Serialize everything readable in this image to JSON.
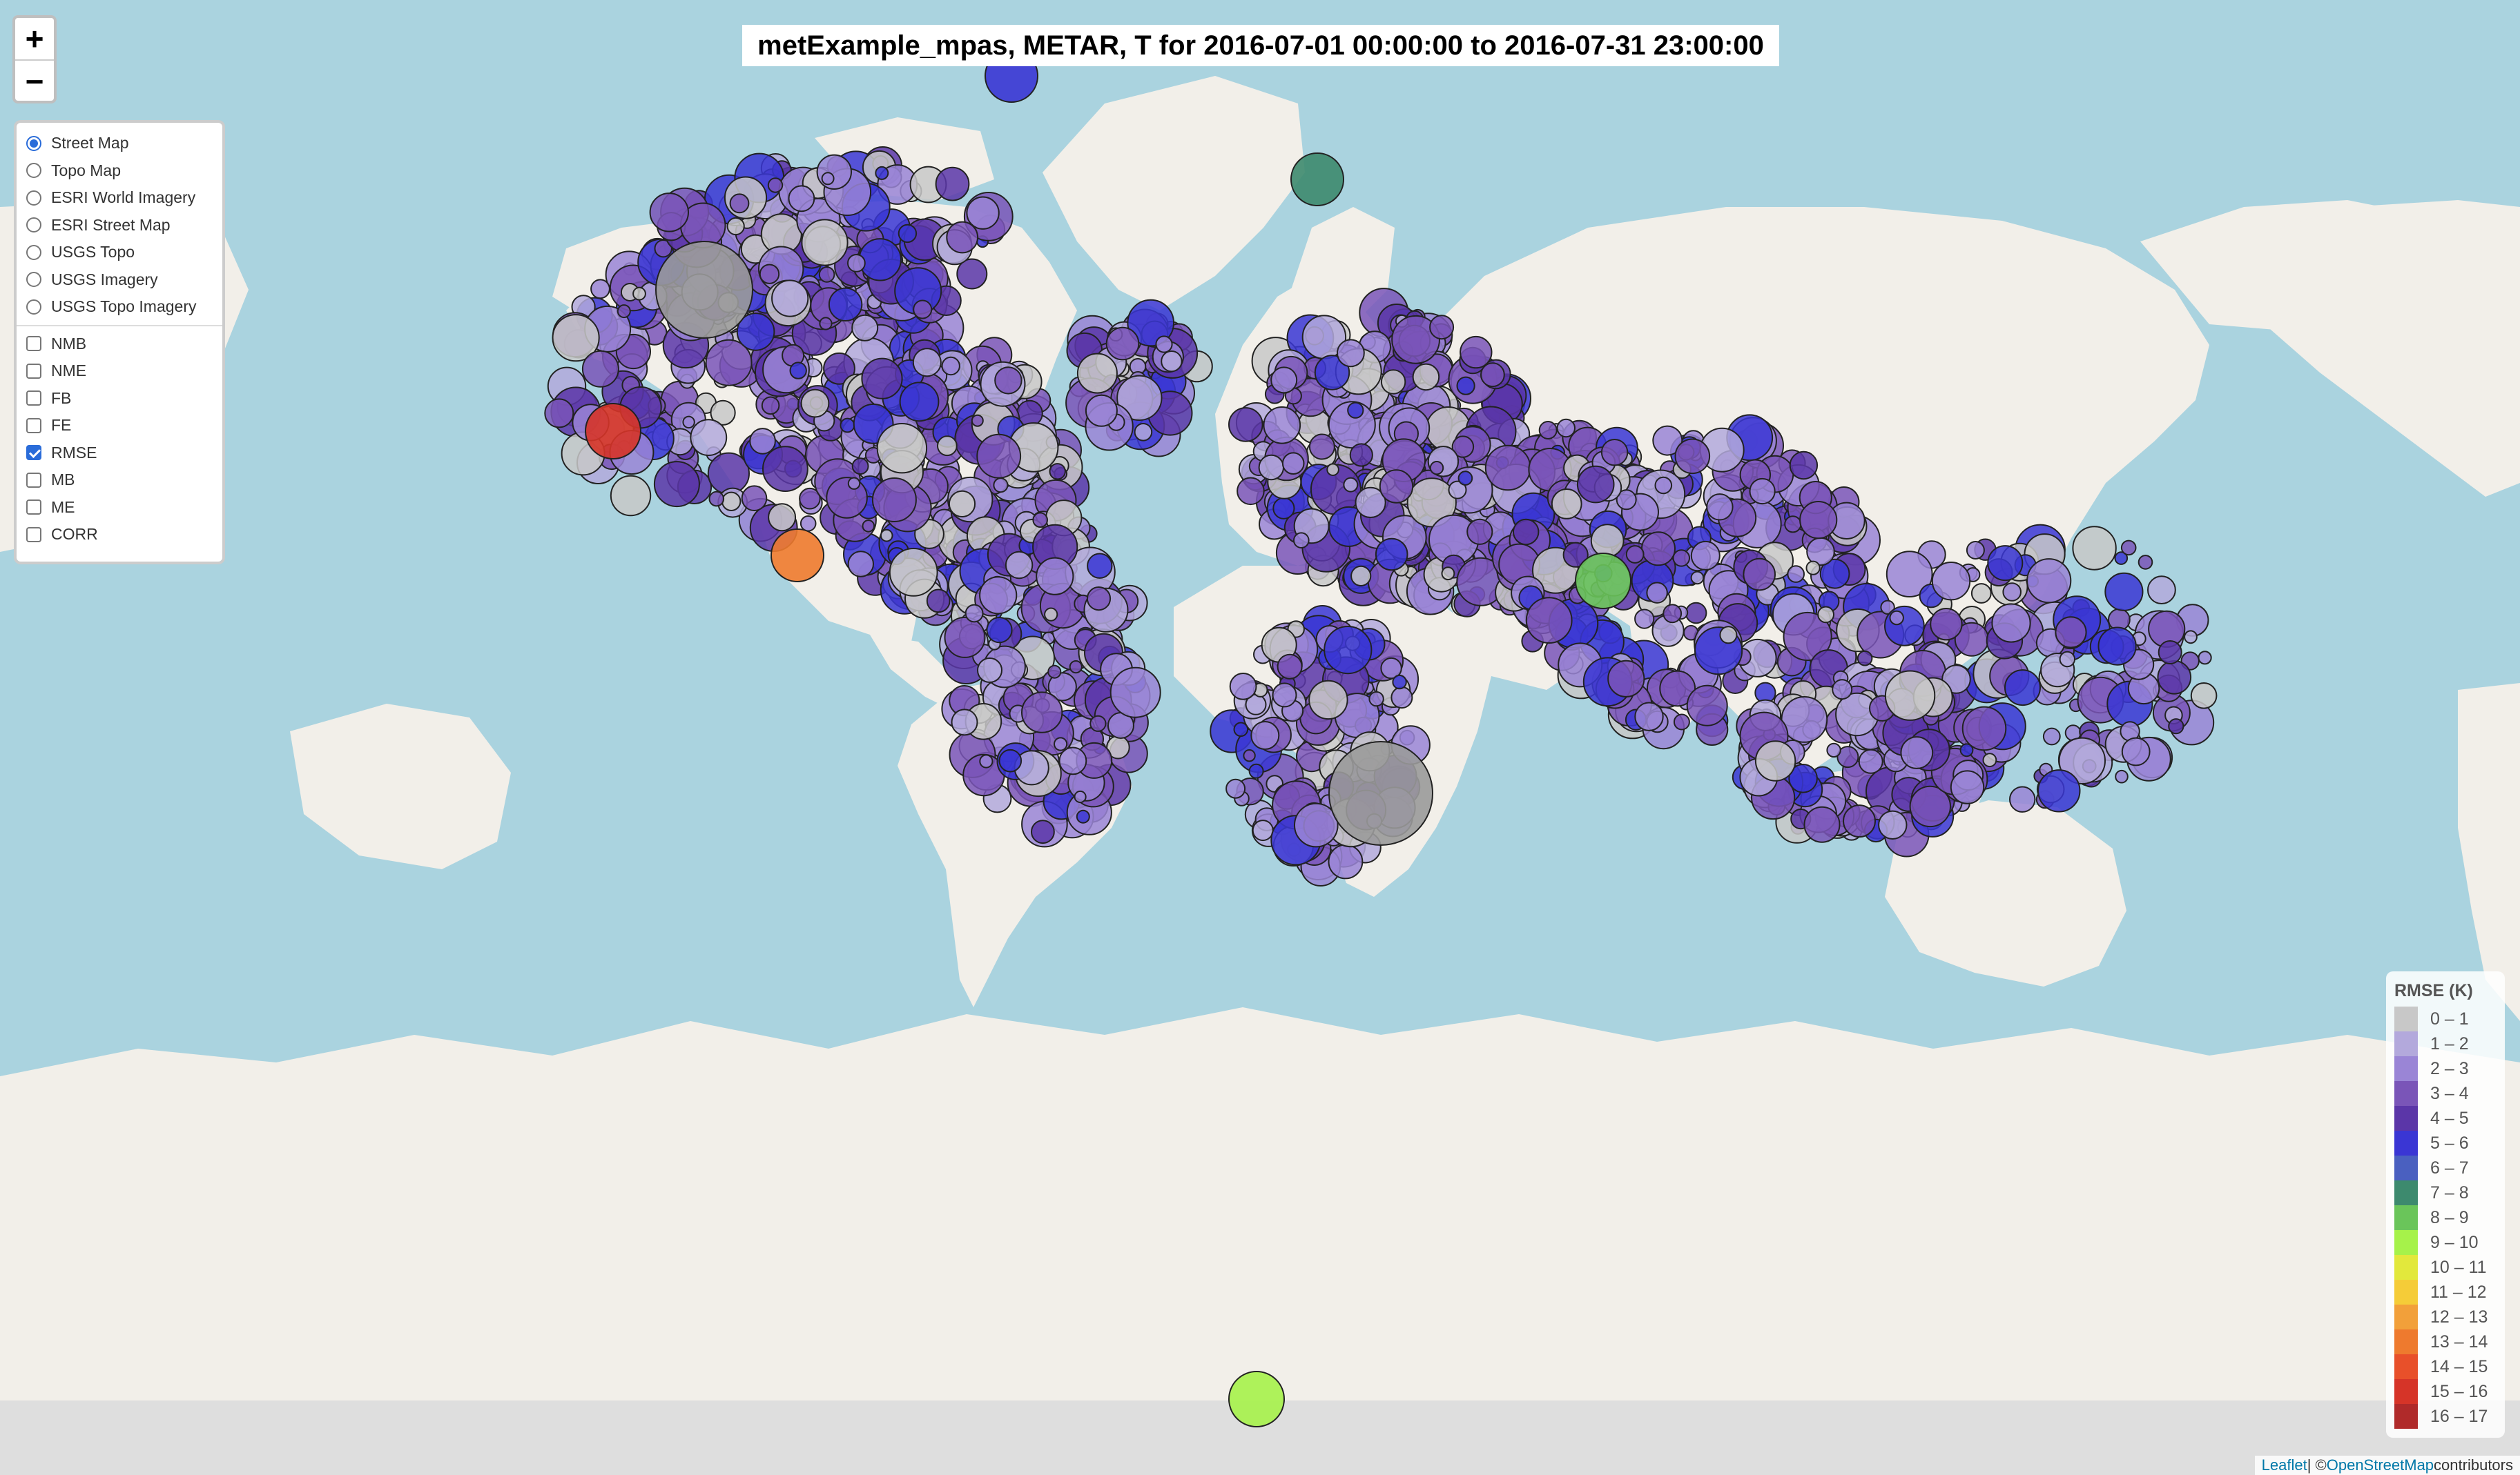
{
  "title": "metExample_mpas, METAR, T for 2016-07-01 00:00:00 to 2016-07-31 23:00:00",
  "zoom": {
    "in_label": "+",
    "out_label": "−"
  },
  "base_layers": [
    {
      "label": "Street Map",
      "selected": true
    },
    {
      "label": "Topo Map",
      "selected": false
    },
    {
      "label": "ESRI World Imagery",
      "selected": false
    },
    {
      "label": "ESRI Street Map",
      "selected": false
    },
    {
      "label": "USGS Topo",
      "selected": false
    },
    {
      "label": "USGS Imagery",
      "selected": false
    },
    {
      "label": "USGS Topo Imagery",
      "selected": false
    }
  ],
  "overlays": [
    {
      "label": "NMB",
      "checked": false
    },
    {
      "label": "NME",
      "checked": false
    },
    {
      "label": "FB",
      "checked": false
    },
    {
      "label": "FE",
      "checked": false
    },
    {
      "label": "RMSE",
      "checked": true
    },
    {
      "label": "MB",
      "checked": false
    },
    {
      "label": "ME",
      "checked": false
    },
    {
      "label": "CORR",
      "checked": false
    }
  ],
  "legend": {
    "title": "RMSE (K)",
    "items": [
      {
        "label": "0 – 1",
        "color": "#c8c8c8"
      },
      {
        "label": "1 – 2",
        "color": "#b3a9dc"
      },
      {
        "label": "2 – 3",
        "color": "#9a85d6"
      },
      {
        "label": "3 – 4",
        "color": "#7a55b8"
      },
      {
        "label": "4 – 5",
        "color": "#5b36a8"
      },
      {
        "label": "5 – 6",
        "color": "#3a36d4"
      },
      {
        "label": "6 – 7",
        "color": "#4a60c0"
      },
      {
        "label": "7 – 8",
        "color": "#3d8a6e"
      },
      {
        "label": "8 – 9",
        "color": "#6ac55a"
      },
      {
        "label": "9 – 10",
        "color": "#a6f24a"
      },
      {
        "label": "10 – 11",
        "color": "#e2e83c"
      },
      {
        "label": "11 – 12",
        "color": "#f5cc38"
      },
      {
        "label": "12 – 13",
        "color": "#f2a03a"
      },
      {
        "label": "13 – 14",
        "color": "#ee7a2e"
      },
      {
        "label": "14 – 15",
        "color": "#e8502a"
      },
      {
        "label": "15 – 16",
        "color": "#d63428"
      },
      {
        "label": "16 – 17",
        "color": "#b02a2a"
      }
    ]
  },
  "attribution": {
    "leaflet": "Leaflet",
    "sep": " | © ",
    "osm": "OpenStreetMap",
    "suffix": " contributors"
  },
  "map_colors": {
    "ocean": "#aad3df",
    "land": "#f2efe9",
    "ice": "#f2f2f2"
  }
}
